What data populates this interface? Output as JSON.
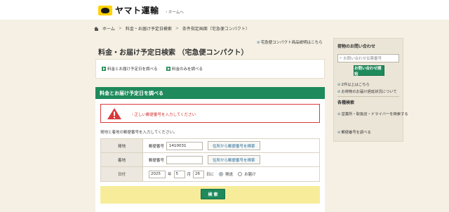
{
  "header": {
    "logo_text": "ヤマト運輸",
    "home_link": "・ホームへ"
  },
  "breadcrumb": {
    "items": [
      "ホーム",
      "料金・お届け予定日検索",
      "条件指定画面（宅急便コンパクト）"
    ],
    "separator": ">"
  },
  "guide_link": "宅急便コンパクト商品説明はこちら",
  "page_title": "料金・お届け予定日検索 （宅急便コンパクト）",
  "tabs": [
    {
      "label": "料金とお届け予定日を調べる"
    },
    {
      "label": "料金のみを調べる"
    }
  ],
  "panel": {
    "title": "料金とお届け予定日を調べる",
    "error": "・正しい郵便番号を入力してください",
    "intro": "発地と着地の郵便番号を入力してください。",
    "origin": {
      "label": "発地",
      "zip_label": "郵便番号",
      "zip_value": "1410031",
      "search_button": "住所から郵便番号を検索"
    },
    "destination": {
      "label": "着地",
      "zip_label": "郵便番号",
      "zip_value": "",
      "search_button": "住所から郵便番号を検索"
    },
    "date": {
      "label": "日付",
      "year": "2025",
      "year_unit": "年",
      "month": "5",
      "month_unit": "月",
      "day": "26",
      "day_unit": "日に",
      "option_send": "発送",
      "option_deliver": "お届け",
      "selected": "発送"
    },
    "submit": "検 索"
  },
  "sidebar": {
    "tracking_title": "荷物のお問い合わせ",
    "tracking_placeholder": "お問い合わせ伝票番号",
    "tracking_button": "お問い合わせ開始",
    "multi_link": "2件以上はこちら",
    "delay_link": "お荷物のお届け遅延状況について",
    "search_title": "各種検索",
    "office_link": "営業所・取扱店・ドライバーを検索する",
    "zip_link": "郵便番号を調べる"
  },
  "colors": {
    "brand_green": "#1f8a5c",
    "error_red": "#d0302f",
    "logo_yellow": "#ffd200",
    "submit_bg": "#f7ec9a"
  }
}
